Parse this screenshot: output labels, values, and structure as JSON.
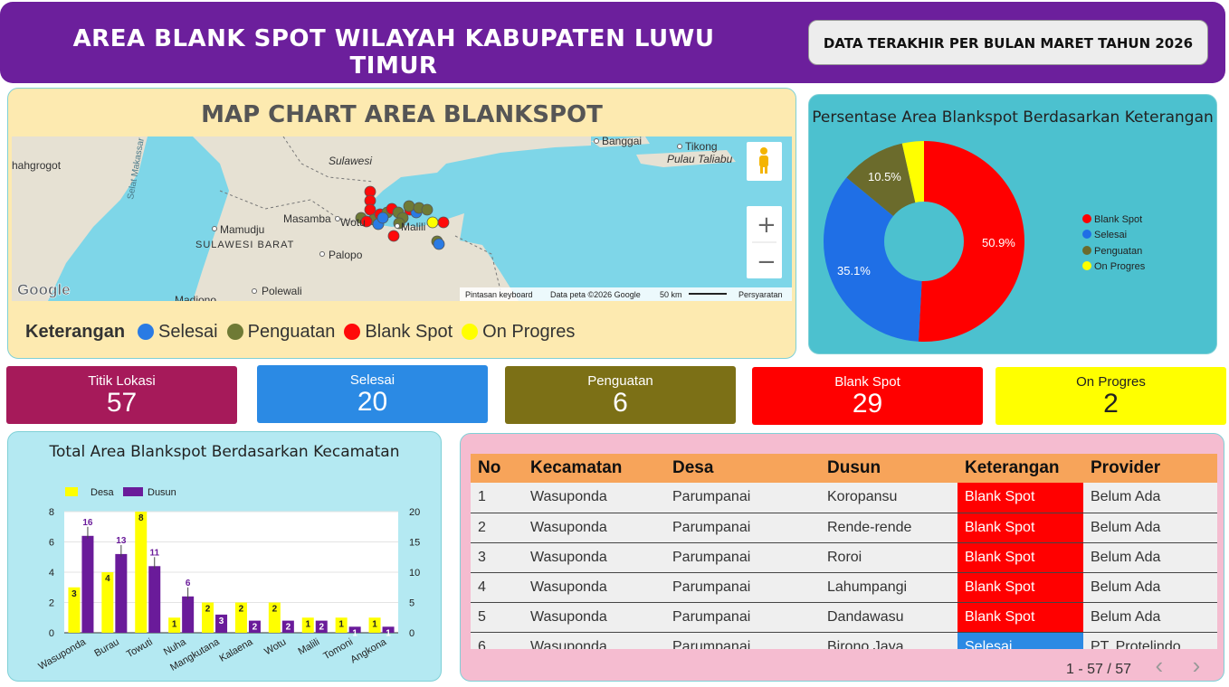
{
  "header": {
    "title": "AREA BLANK SPOT WILAYAH KABUPATEN LUWU TIMUR",
    "update_label": "DATA TERAKHIR PER BULAN MARET TAHUN 2026"
  },
  "map": {
    "title": "MAP CHART AREA BLANKSPOT",
    "place_labels": [
      "hahgrogot",
      "Selat Makassar",
      "Sulawesi",
      "Banggai",
      "Tikong",
      "Pulau Taliabu",
      "Mamudju",
      "Masamba",
      "Wotu",
      "Malili",
      "SULAWESI BARAT",
      "Palopo",
      "Polewali",
      "Madiono"
    ],
    "attribution": [
      "Pintasan keyboard",
      "Data peta ©2026 Google",
      "50 km",
      "Persyaratan"
    ],
    "google_logo": "Google",
    "zoom_in": "+",
    "zoom_out": "−",
    "legend_title": "Keterangan",
    "legend": [
      {
        "label": "Selesai",
        "color": "#2a7be4"
      },
      {
        "label": "Penguatan",
        "color": "#6f7a35"
      },
      {
        "label": "Blank Spot",
        "color": "#ff0a0a"
      },
      {
        "label": "On Progres",
        "color": "#ffff00"
      }
    ]
  },
  "pie": {
    "title": "Persentase Area Blankspot Berdasarkan Keterangan",
    "slice_labels": [
      "50.9%",
      "35.1%",
      "10.5%"
    ],
    "legend": [
      {
        "label": "Blank Spot",
        "color": "#ff0000"
      },
      {
        "label": "Selesai",
        "color": "#1f6fe6"
      },
      {
        "label": "Penguatan",
        "color": "#6b6b2c"
      },
      {
        "label": "On Progres",
        "color": "#ffff00"
      }
    ]
  },
  "kpis": [
    {
      "label": "Titik Lokasi",
      "value": "57",
      "bg": "#a61a5a",
      "fg": "#ffffff"
    },
    {
      "label": "Selesai",
      "value": "20",
      "bg": "#2b8ae4",
      "fg": "#ffffff"
    },
    {
      "label": "Penguatan",
      "value": "6",
      "bg": "#7c7016",
      "fg": "#ffffff"
    },
    {
      "label": "Blank Spot",
      "value": "29",
      "bg": "#ff0000",
      "fg": "#ffffff"
    },
    {
      "label": "On Progres",
      "value": "2",
      "bg": "#ffff00",
      "fg": "#222222"
    }
  ],
  "chart_data": [
    {
      "type": "pie",
      "title": "Persentase Area Blankspot Berdasarkan Keterangan",
      "labels": [
        "Blank Spot",
        "Selesai",
        "Penguatan",
        "On Progres"
      ],
      "values": [
        29,
        20,
        6,
        2
      ],
      "percent_labels": [
        "50.9%",
        "35.1%",
        "10.5%",
        ""
      ],
      "colors": [
        "#ff0000",
        "#1f6fe6",
        "#6b6b2c",
        "#ffff00"
      ],
      "donut": true,
      "legend_position": "right"
    },
    {
      "type": "bar",
      "title": "Total Area Blankspot Berdasarkan Kecamatan",
      "categories": [
        "Wasuponda",
        "Burau",
        "Towuti",
        "Nuha",
        "Mangkutana",
        "Kalaena",
        "Wotu",
        "Malili",
        "Tomoni",
        "Angkona"
      ],
      "series": [
        {
          "name": "Desa",
          "values": [
            3,
            4,
            8,
            1,
            2,
            2,
            2,
            1,
            1,
            1
          ],
          "color": "#ffff00",
          "axis": "left"
        },
        {
          "name": "Dusun",
          "values": [
            16,
            13,
            11,
            6,
            3,
            2,
            2,
            2,
            1,
            1
          ],
          "color": "#6a1b9a",
          "axis": "right"
        }
      ],
      "ylim_left": [
        0,
        8
      ],
      "yticks_left": [
        "0",
        "2",
        "4",
        "6",
        "8"
      ],
      "ylim_right": [
        0,
        20
      ],
      "yticks_right": [
        "0",
        "5",
        "10",
        "15",
        "20"
      ],
      "legend_position": "top-left",
      "grid": true
    }
  ],
  "table": {
    "columns": [
      "No",
      "Kecamatan",
      "Desa",
      "Dusun",
      "Keterangan",
      "Provider"
    ],
    "rows": [
      [
        "1",
        "Wasuponda",
        "Parumpanai",
        "Koropansu",
        "Blank Spot",
        "Belum Ada"
      ],
      [
        "2",
        "Wasuponda",
        "Parumpanai",
        "Rende-rende",
        "Blank Spot",
        "Belum Ada"
      ],
      [
        "3",
        "Wasuponda",
        "Parumpanai",
        "Roroi",
        "Blank Spot",
        "Belum Ada"
      ],
      [
        "4",
        "Wasuponda",
        "Parumpanai",
        "Lahumpangi",
        "Blank Spot",
        "Belum Ada"
      ],
      [
        "5",
        "Wasuponda",
        "Parumpanai",
        "Dandawasu",
        "Blank Spot",
        "Belum Ada"
      ],
      [
        "6",
        "Wasuponda",
        "Parumpanai",
        "Birono Jaya",
        "Selesai",
        "PT. Protelindo"
      ]
    ],
    "status_colors": {
      "Blank Spot": "#ff0000",
      "Selesai": "#2b8ae4"
    },
    "pagination": "1 - 57 / 57",
    "prev": "‹",
    "next": "›"
  }
}
